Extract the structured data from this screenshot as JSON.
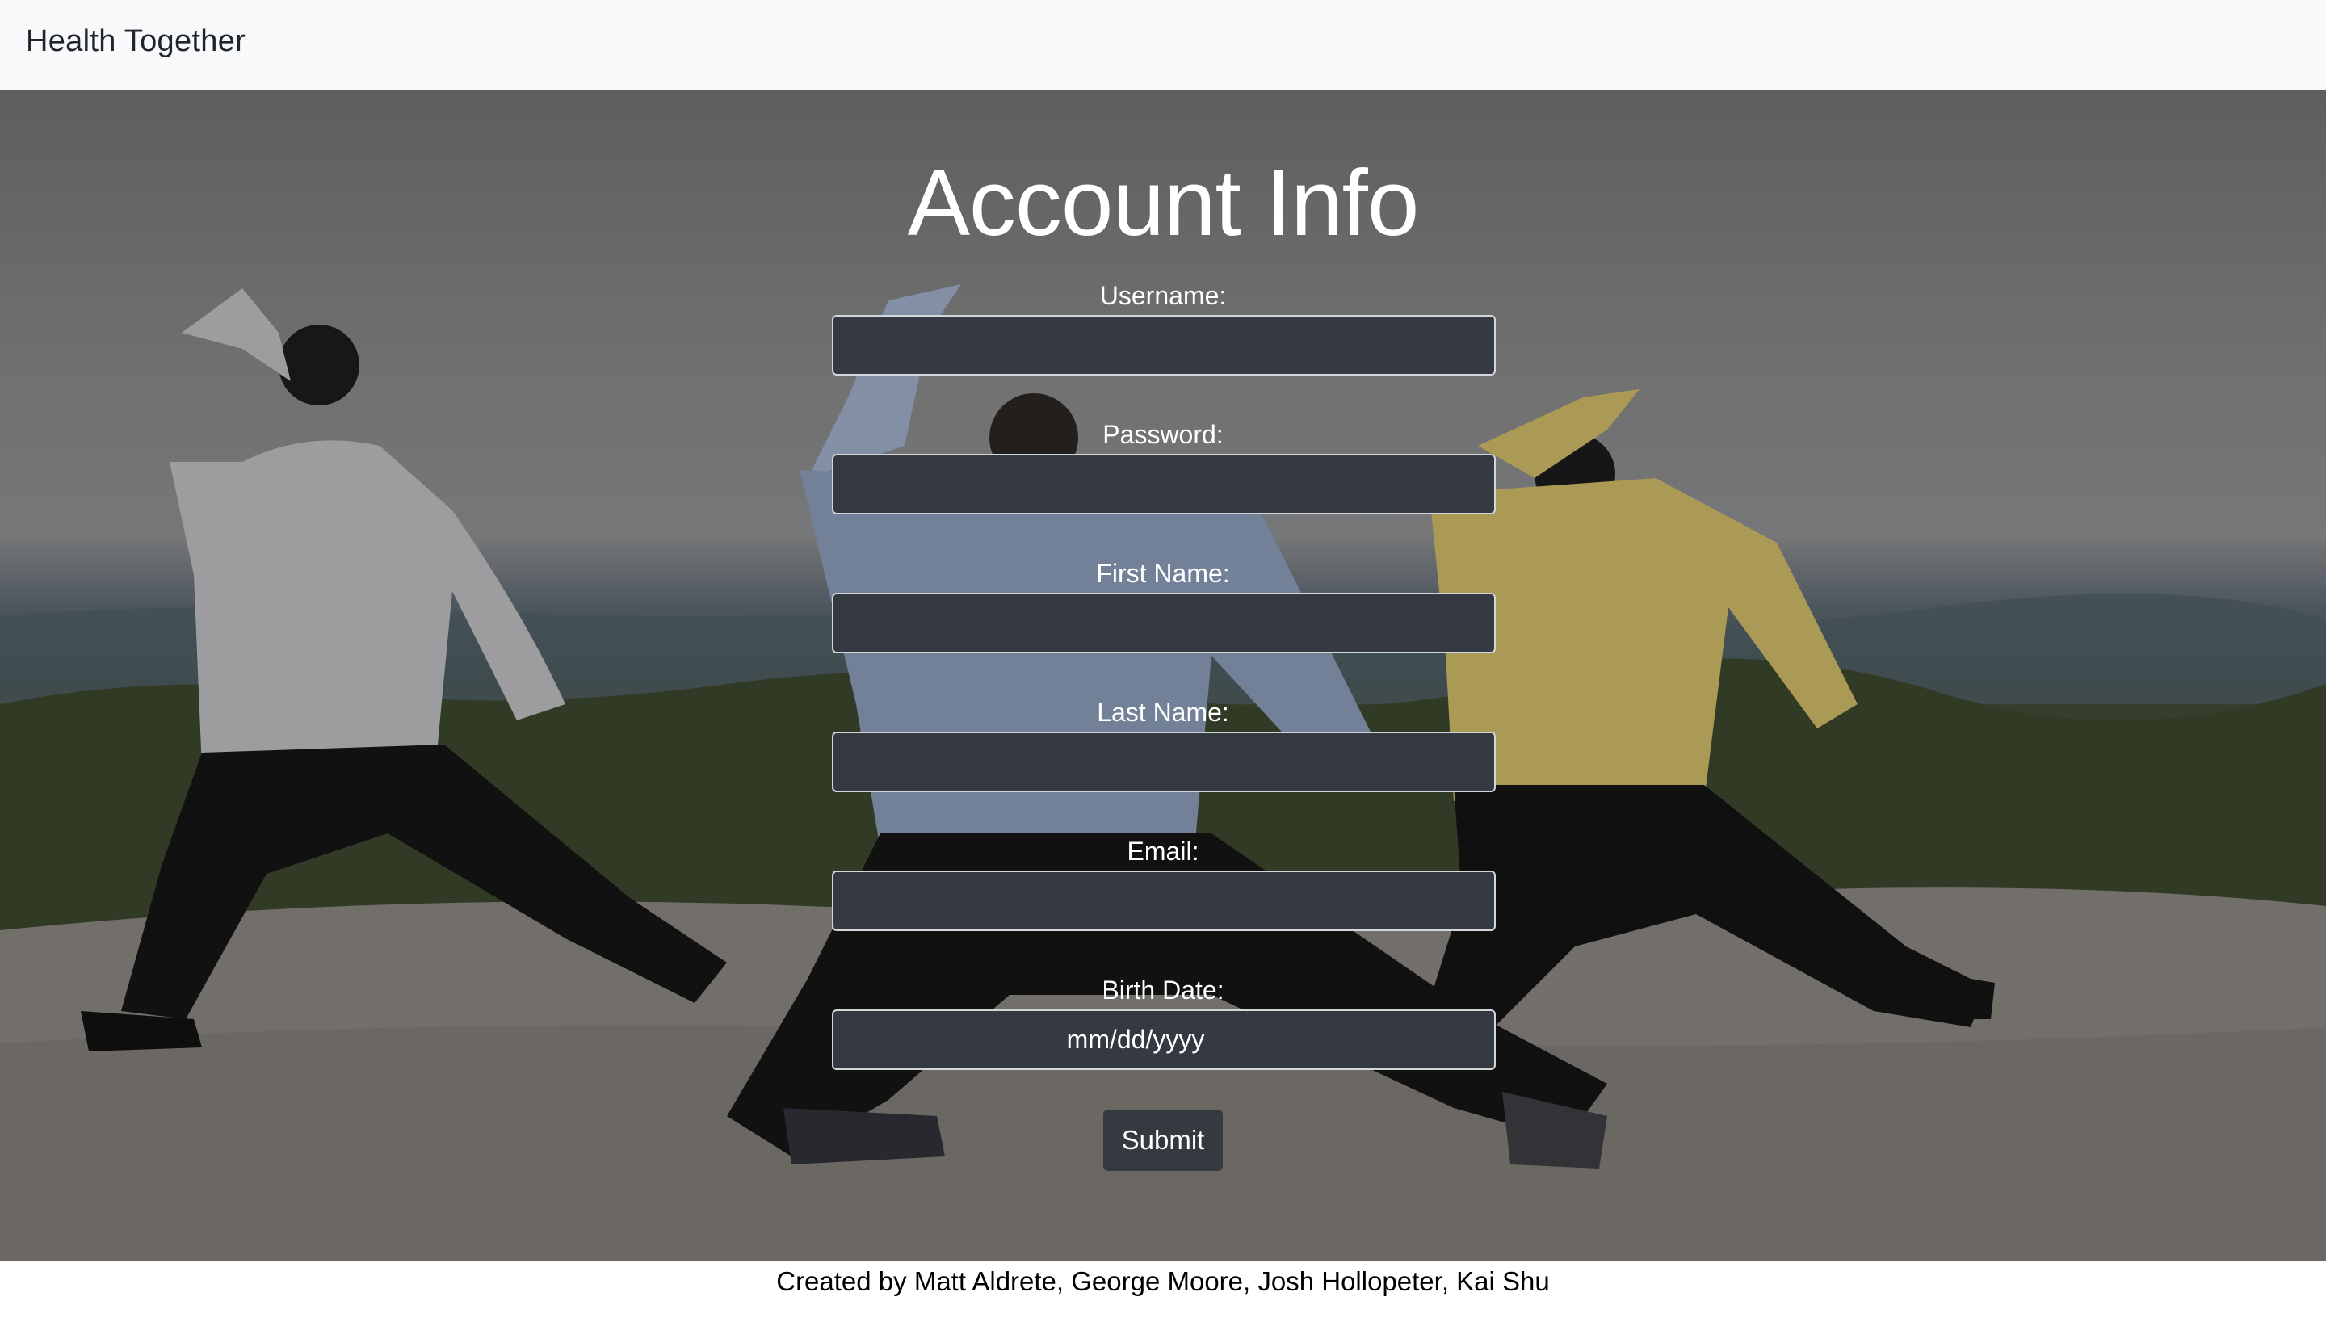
{
  "navbar": {
    "brand": "Health Together"
  },
  "page": {
    "title": "Account Info"
  },
  "form": {
    "fields": [
      {
        "label": "Username:",
        "value": "",
        "placeholder": ""
      },
      {
        "label": "Password:",
        "value": "",
        "placeholder": ""
      },
      {
        "label": "First Name:",
        "value": "",
        "placeholder": ""
      },
      {
        "label": "Last Name:",
        "value": "",
        "placeholder": ""
      },
      {
        "label": "Email:",
        "value": "",
        "placeholder": ""
      },
      {
        "label": "Birth Date:",
        "value": "mm/dd/yyyy",
        "placeholder": "mm/dd/yyyy"
      }
    ],
    "submit_label": "Submit"
  },
  "footer": {
    "credits": "Created by Matt Aldrete, George Moore, Josh Hollopeter, Kai Shu"
  },
  "colors": {
    "navbar_bg": "#f8f9fa",
    "input_bg": "#353a42",
    "input_border": "#d4d7da",
    "button_bg": "#343a40",
    "text_light": "#ffffff"
  }
}
